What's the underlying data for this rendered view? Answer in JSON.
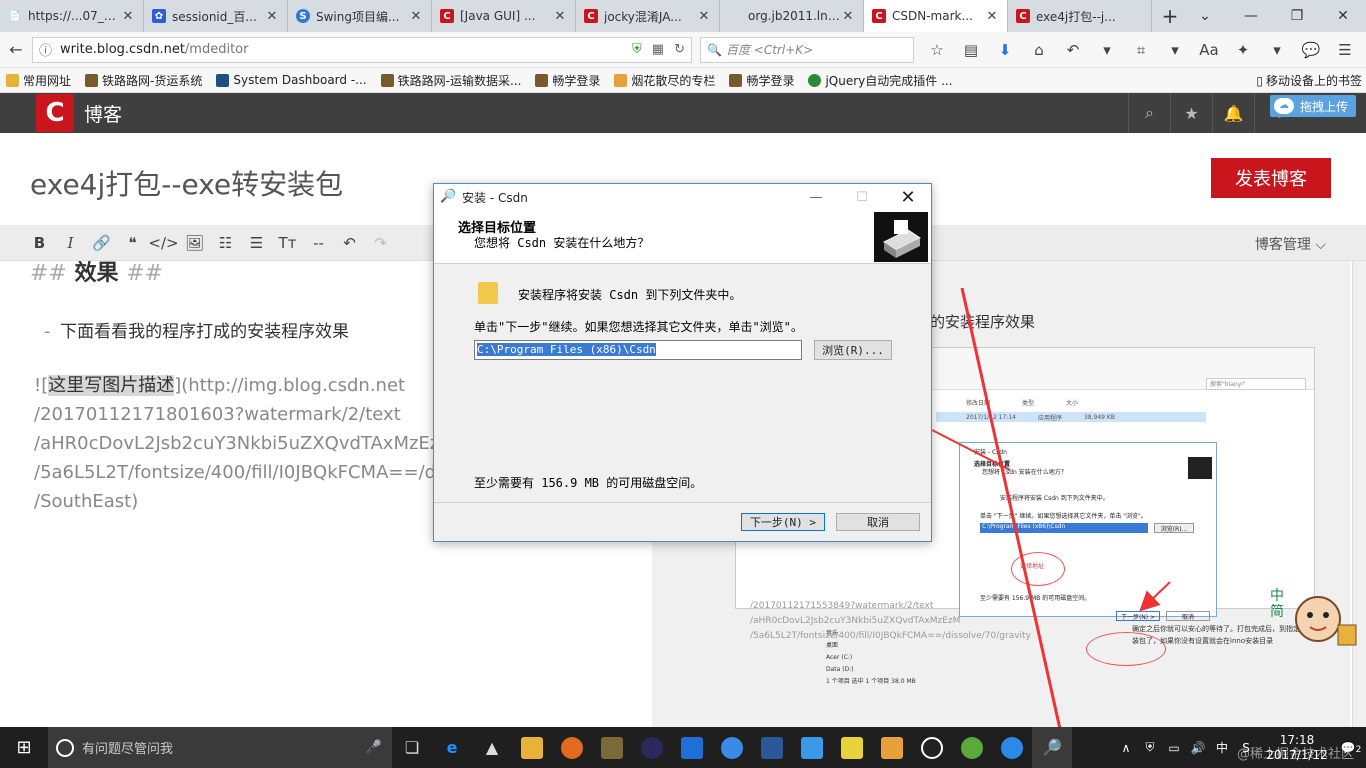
{
  "browser": {
    "tabs": [
      {
        "title": "https://...07_yaff",
        "favicon": "none"
      },
      {
        "title": "sessionid_百...",
        "favicon": "paw"
      },
      {
        "title": "Swing项目编...",
        "favicon": "swing"
      },
      {
        "title": "[Java GUI] ...",
        "favicon": "csdn"
      },
      {
        "title": "jocky混淆JA...",
        "favicon": "csdn"
      },
      {
        "title": "org.jb2011.lnf.b...",
        "favicon": "none"
      },
      {
        "title": "CSDN-mark...",
        "favicon": "csdn",
        "active": true
      },
      {
        "title": "exe4j打包--j...",
        "favicon": "csdn"
      }
    ],
    "url_host": "write.blog.csdn.net",
    "url_path": "/mdeditor",
    "search_placeholder": "百度 <Ctrl+K>",
    "bookmarks": [
      "常用网址",
      "铁路路网-货运系统",
      "System Dashboard -...",
      "铁路路网-运输数据采...",
      "畅学登录",
      "烟花散尽的专栏",
      "畅学登录",
      "jQuery自动完成插件 ..."
    ],
    "mobile_bookmarks": "移动设备上的书签"
  },
  "csdn": {
    "logo_letter": "C",
    "brand": "博客",
    "upload_label": "拖拽上传"
  },
  "editor": {
    "article_title": "exe4j打包--exe转安装包",
    "publish_label": "发表博客",
    "blog_manage": "博客管理",
    "heading_hash_open": "##",
    "heading_text": "效果",
    "heading_hash_close": "##",
    "list_marker": "-",
    "list_text": "下面看看我的程序打成的安装程序效果",
    "img_prefix": "![",
    "img_alt": "这里写图片描述",
    "img_url_lines": [
      "](http://img.blog.csdn.net",
      "/20170112171801603?watermark/2/text",
      "/aHR0cDovL2Jsb2cuY3Nkbi5uZXQvdTAxMzEzM",
      "/5a6L5L2T/fontsize/400/fill/I0JBQkFCMA==/di",
      "/SouthEast)"
    ]
  },
  "preview": {
    "text": "的安装程序效果",
    "search": "搜索\"bianyi\"",
    "cols": [
      "修改日期",
      "类型",
      "大小"
    ],
    "row": [
      "2017/1/12 17:14",
      "应用程序",
      "38,949 KB"
    ],
    "dlg_title": "安装 - Csdn",
    "dlg_h1": "选择目标位置",
    "dlg_h2": "您想将 Csdn 安装在什么地方？",
    "dlg_body1": "安装程序将安装 Csdn 到下列文件夹中。",
    "dlg_body2": "单击 \"下一步\" 继续。如果您想选择其它文件夹，单击 \"浏览\"。",
    "dlg_path": "C:\\Program Files (x86)\\Csdn",
    "dlg_browse": "浏览(R)...",
    "dlg_note": "选择地址",
    "dlg_space": "至少需要有 156.9 MB 的可用磁盘空间。",
    "dlg_next": "下一步(N) >",
    "dlg_cancel": "取消",
    "nav_items": [
      "音乐",
      "桌面",
      "Acer (C:)",
      "Data (D:)",
      "1 个项目    选中 1 个项目 38.0 MB"
    ],
    "url_lines": [
      "/20170112171553849?watermark/2/text",
      "/aHR0cDovL2Jsb2cuY3Nkbi5uZXQvdTAxMzEzM",
      "/5a6L5L2T/fontsize/400/fill/I0JBQkFCMA==/dissolve/70/gravity"
    ],
    "foot_text": "确定之后你就可以安心的等待了。打包完成后，到指定路径找安装包了，如果你没有设置就会在inno安装目录"
  },
  "dialog": {
    "title": "安装 - Csdn",
    "h1": "选择目标位置",
    "h2": "您想将 Csdn 安装在什么地方？",
    "msg1": "安装程序将安装 Csdn 到下列文件夹中。",
    "msg2": "单击\"下一步\"继续。如果您想选择其它文件夹，单击\"浏览\"。",
    "path": "C:\\Program Files (x86)\\Csdn",
    "browse": "浏览(R)...",
    "space": "至少需要有 156.9 MB 的可用磁盘空间。",
    "next": "下一步(N) >",
    "cancel": "取消"
  },
  "side": {
    "cn_chars": "中\n简"
  },
  "taskbar": {
    "search_placeholder": "有问题尽管问我",
    "ime": "中",
    "time": "17:18",
    "date": "2017/1/12",
    "notifications": "2",
    "watermark": "@稀土掘金技术社区"
  }
}
